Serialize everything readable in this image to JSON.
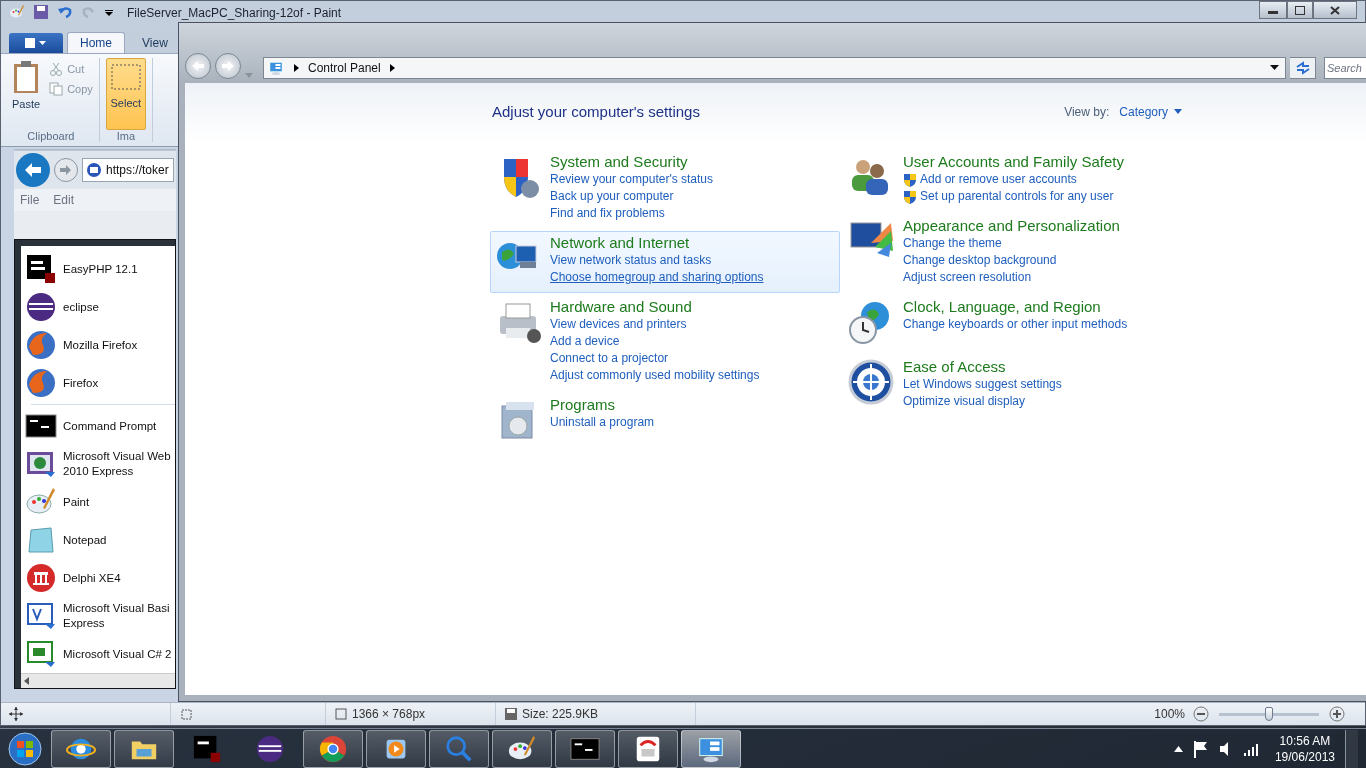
{
  "paint": {
    "title": "FileServer_MacPC_Sharing-12of - Paint",
    "tabs": [
      {
        "label": "Home",
        "selected": true
      },
      {
        "label": "View",
        "selected": false
      }
    ],
    "clipboard": {
      "paste": "Paste",
      "cut": "Cut",
      "copy": "Copy",
      "group": "Clipboard"
    },
    "select": {
      "label": "Select",
      "selected": true
    },
    "image_group": "Ima",
    "canvas": {
      "browser": {
        "url": "https://toker",
        "menu": [
          "File",
          "Edit"
        ]
      },
      "start_menu": {
        "pinned": [
          {
            "lines": [
              "EasyPHP 12.1"
            ]
          },
          {
            "lines": [
              "eclipse"
            ]
          },
          {
            "lines": [
              "Mozilla Firefox"
            ]
          },
          {
            "lines": [
              "Firefox"
            ]
          }
        ],
        "recent": [
          {
            "lines": [
              "Command Prompt"
            ]
          },
          {
            "lines": [
              "Microsoft Visual Web",
              "2010 Express"
            ]
          },
          {
            "lines": [
              "Paint"
            ]
          },
          {
            "lines": [
              "Notepad"
            ]
          },
          {
            "lines": [
              "Delphi XE4"
            ]
          },
          {
            "lines": [
              "Microsoft Visual Basi",
              "Express"
            ]
          },
          {
            "lines": [
              "Microsoft Visual C# 2"
            ]
          }
        ]
      }
    },
    "status": {
      "dimensions": "1366 × 768px",
      "size": "Size: 225.9KB",
      "zoom": "100%",
      "zoom_level": {
        "level": 0.5
      }
    }
  },
  "control_panel": {
    "breadcrumb": "Control Panel",
    "search": {
      "placeholder": "Search"
    },
    "heading": "Adjust your computer's settings",
    "view_by": {
      "label": "View by:",
      "value": "Category"
    },
    "columns": [
      [
        {
          "title": "System and Security",
          "highlighted": false,
          "admin_links": false,
          "links": [
            {
              "text": "Review your computer's status",
              "hovered": false
            },
            {
              "text": "Back up your computer",
              "hovered": false
            },
            {
              "text": "Find and fix problems",
              "hovered": false
            }
          ]
        },
        {
          "title": "Network and Internet",
          "highlighted": true,
          "admin_links": false,
          "links": [
            {
              "text": "View network status and tasks",
              "hovered": false
            },
            {
              "text": "Choose homegroup and sharing options",
              "hovered": true
            }
          ]
        },
        {
          "title": "Hardware and Sound",
          "highlighted": false,
          "admin_links": false,
          "links": [
            {
              "text": "View devices and printers",
              "hovered": false
            },
            {
              "text": "Add a device",
              "hovered": false
            },
            {
              "text": "Connect to a projector",
              "hovered": false
            },
            {
              "text": "Adjust commonly used mobility settings",
              "hovered": false
            }
          ]
        },
        {
          "title": "Programs",
          "highlighted": false,
          "admin_links": false,
          "links": [
            {
              "text": "Uninstall a program",
              "hovered": false
            }
          ]
        }
      ],
      [
        {
          "title": "User Accounts and Family Safety",
          "highlighted": false,
          "admin_links": true,
          "links": [
            {
              "text": "Add or remove user accounts",
              "hovered": false
            },
            {
              "text": "Set up parental controls for any user",
              "hovered": false
            }
          ]
        },
        {
          "title": "Appearance and Personalization",
          "highlighted": false,
          "admin_links": false,
          "links": [
            {
              "text": "Change the theme",
              "hovered": false
            },
            {
              "text": "Change desktop background",
              "hovered": false
            },
            {
              "text": "Adjust screen resolution",
              "hovered": false
            }
          ]
        },
        {
          "title": "Clock, Language, and Region",
          "highlighted": false,
          "admin_links": false,
          "links": [
            {
              "text": "Change keyboards or other input methods",
              "hovered": false
            }
          ]
        },
        {
          "title": "Ease of Access",
          "highlighted": false,
          "admin_links": false,
          "links": [
            {
              "text": "Let Windows suggest settings",
              "hovered": false
            },
            {
              "text": "Optimize visual display",
              "hovered": false
            }
          ]
        }
      ]
    ]
  },
  "taskbar": {
    "apps": [
      {
        "running": true,
        "active": false
      },
      {
        "running": true,
        "active": false
      },
      {
        "running": false,
        "active": false
      },
      {
        "running": false,
        "active": false
      },
      {
        "running": true,
        "active": false
      },
      {
        "running": true,
        "active": false
      },
      {
        "running": true,
        "active": false
      },
      {
        "running": true,
        "active": false
      },
      {
        "running": true,
        "active": false
      },
      {
        "running": true,
        "active": false
      },
      {
        "running": true,
        "active": true
      }
    ],
    "time": "10:56 AM",
    "date": "19/06/2013"
  }
}
